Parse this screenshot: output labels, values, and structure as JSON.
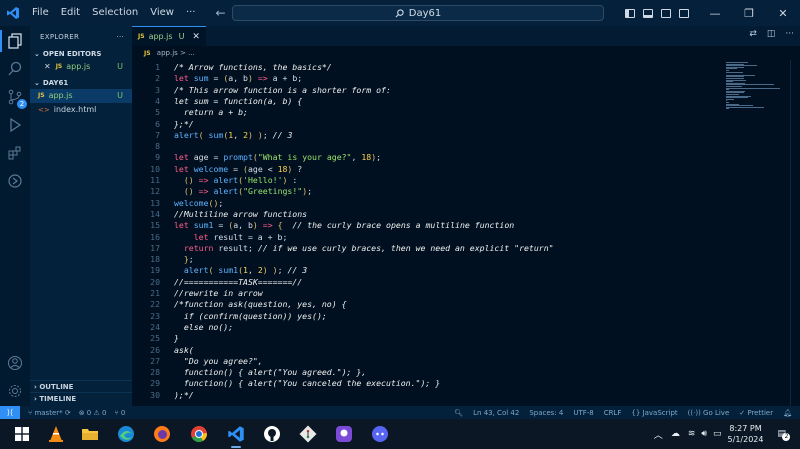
{
  "titlebar": {
    "menu": [
      "File",
      "Edit",
      "Selection",
      "View",
      "···"
    ],
    "search": "Day61",
    "window_controls": [
      "—",
      "❐",
      "✕"
    ]
  },
  "activity": {
    "icons": [
      "explorer-icon",
      "search-icon",
      "source-control-icon",
      "run-debug-icon",
      "extensions-icon",
      "remote-icon"
    ],
    "scm_badge": "2"
  },
  "sidebar": {
    "title": "EXPLORER",
    "more": "···",
    "open_editors_label": "OPEN EDITORS",
    "open_editor_file": "app.js",
    "open_editor_status": "U",
    "folder_label": "DAY61",
    "files": [
      {
        "name": "app.js",
        "status": "U",
        "type": "js"
      },
      {
        "name": "index.html",
        "status": "",
        "type": "html"
      }
    ],
    "outline_label": "OUTLINE",
    "timeline_label": "TIMELINE"
  },
  "editor": {
    "tab_label": "app.js",
    "tab_status": "U",
    "breadcrumb": "app.js > ...",
    "lines": [
      {
        "n": "1",
        "t": "/* Arrow functions, the basics*/"
      },
      {
        "n": "2",
        "t": "let sum = (a, b) => a + b;"
      },
      {
        "n": "3",
        "t": "/* This arrow function is a shorter form of:"
      },
      {
        "n": "4",
        "t": "let sum = function(a, b) {"
      },
      {
        "n": "5",
        "t": "  return a + b;"
      },
      {
        "n": "6",
        "t": "};*/"
      },
      {
        "n": "7",
        "t": "alert( sum(1, 2) ); // 3"
      },
      {
        "n": "8",
        "t": ""
      },
      {
        "n": "9",
        "t": "let age = prompt(\"What is your age?\", 18);"
      },
      {
        "n": "10",
        "t": "let welcome = (age < 18) ?"
      },
      {
        "n": "11",
        "t": "  () => alert('Hello!') :"
      },
      {
        "n": "12",
        "t": "  () => alert(\"Greetings!\");"
      },
      {
        "n": "13",
        "t": "welcome();"
      },
      {
        "n": "14",
        "t": "//Multiline arrow functions"
      },
      {
        "n": "15",
        "t": "let sum1 = (a, b) => {  // the curly brace opens a multiline function"
      },
      {
        "n": "16",
        "t": "    let result = a + b;"
      },
      {
        "n": "17",
        "t": "  return result; // if we use curly braces, then we need an explicit \"return\""
      },
      {
        "n": "18",
        "t": "  };"
      },
      {
        "n": "19",
        "t": "  alert( sum1(1, 2) ); // 3"
      },
      {
        "n": "20",
        "t": "//===========TASK=======//"
      },
      {
        "n": "21",
        "t": "//rewrite in arrow"
      },
      {
        "n": "22",
        "t": "/*function ask(question, yes, no) {"
      },
      {
        "n": "23",
        "t": "  if (confirm(question)) yes();"
      },
      {
        "n": "24",
        "t": "  else no();"
      },
      {
        "n": "25",
        "t": "}"
      },
      {
        "n": "26",
        "t": "ask("
      },
      {
        "n": "27",
        "t": "  \"Do you agree?\","
      },
      {
        "n": "28",
        "t": "  function() { alert(\"You agreed.\"); },"
      },
      {
        "n": "29",
        "t": "  function() { alert(\"You canceled the execution.\"); }"
      },
      {
        "n": "30",
        "t": ");*/"
      }
    ]
  },
  "statusbar": {
    "branch": "master*",
    "errors": "⊗ 0 ⚠ 0",
    "ports": "⑂ 0",
    "position": "Ln 43, Col 42",
    "spaces": "Spaces: 4",
    "encoding": "UTF-8",
    "eol": "CRLF",
    "language": "{} JavaScript",
    "golive": "Go Live",
    "prettier": "✓ Prettier"
  },
  "taskbar": {
    "time": "8:27 PM",
    "date": "5/1/2024",
    "notif": "2"
  },
  "colors": {
    "accent": "#2f8ff5",
    "keyword": "#ff5c8a",
    "function": "#5fb2ff",
    "string": "#9be36b",
    "number": "#ffd24d"
  }
}
